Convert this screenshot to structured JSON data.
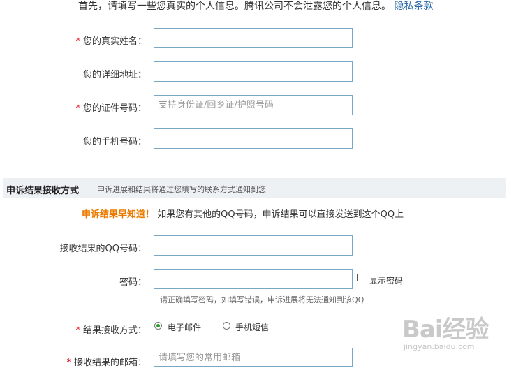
{
  "intro": {
    "text": "首先，请填写一些您真实的个人信息。腾讯公司不会泄露您的个人信息。",
    "privacy_link": "隐私条款"
  },
  "personal": {
    "name_label": "您的真实姓名：",
    "address_label": "您的详细地址：",
    "id_label": "您的证件号码：",
    "id_placeholder": "支持身份证/回乡证/护照号码",
    "phone_label": "您的手机号码："
  },
  "section": {
    "title": "申诉结果接收方式",
    "subtitle": "申诉进展和结果将通过您填写的联系方式通知到您"
  },
  "notice": {
    "highlight": "申诉结果早知道！",
    "text": "如果您有其他的QQ号码，申诉结果可以直接发送到这个QQ上"
  },
  "receive": {
    "qq_label": "接收结果的QQ号码：",
    "password_label": "密码：",
    "show_password_label": "显示密码",
    "password_hint": "请正确填写密码，如填写错误，申诉进展将无法通知到该QQ",
    "method_label": "结果接收方式：",
    "method_options": [
      "电子邮件",
      "手机短信"
    ],
    "method_selected": "电子邮件",
    "email_label": "接收结果的邮箱：",
    "email_placeholder": "请填写您的常用邮箱"
  },
  "required_mark": "*",
  "watermark": {
    "brand": "Bai经验",
    "url": "jingyan.baidu.com"
  },
  "colors": {
    "required": "#e60012",
    "highlight": "#ec7a00",
    "link": "#2b6aa6",
    "field_border": "#7aa7c4",
    "section_bg": "#eef1f4",
    "radio_selected": "#2a9a2a"
  }
}
